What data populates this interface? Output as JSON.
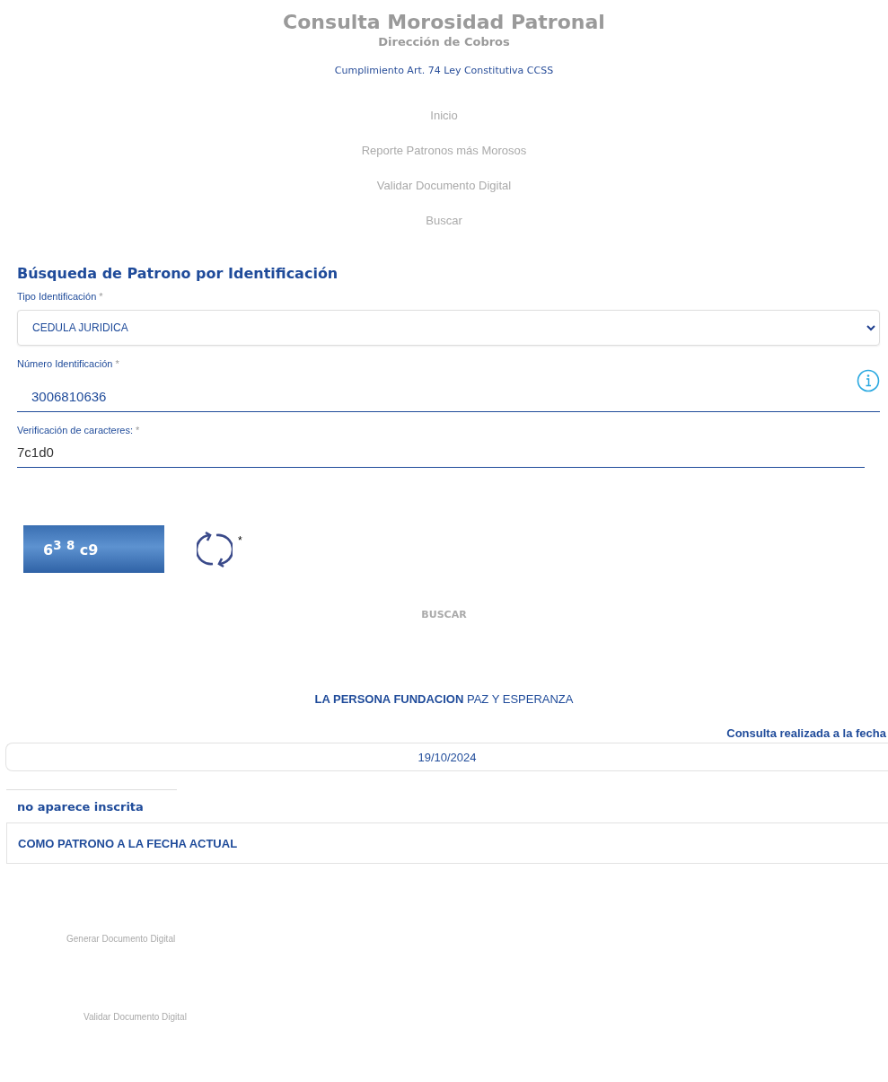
{
  "header": {
    "title": "Consulta Morosidad Patronal",
    "subtitle": "Dirección de Cobros",
    "notice": "Cumplimiento Art. 74 Ley Constitutiva CCSS"
  },
  "nav": [
    "Inicio",
    "Reporte Patronos más Morosos",
    "Validar Documento Digital",
    "Buscar"
  ],
  "search": {
    "title": "Búsqueda de Patrono por Identificación",
    "fields": [
      {
        "kind": "select",
        "label": "Tipo Identificación",
        "mark": "*",
        "value": "CEDULA JURIDICA"
      },
      {
        "kind": "input",
        "label": "Número Identificación",
        "mark": "*",
        "value": "3006810636",
        "info": true
      },
      {
        "kind": "input",
        "label": "Verificación de caracteres:",
        "mark": "*",
        "value": "7c1d0",
        "info": false
      }
    ],
    "captcha": "6$^{3}$ $^{8}$ c9",
    "refresh_mark": "*",
    "button": "BUSCAR"
  },
  "result": {
    "person": "**LA PERSONA FUNDACION** PAZ Y ESPERANZA",
    "date_label": "Consulta realizada a la fecha",
    "date": "19/10/2024",
    "status": "no aparece inscrita",
    "status_detail": "COMO PATRONO A LA FECHA ACTUAL"
  },
  "links": [
    "Generar Documento Digital",
    "Validar Documento Digital"
  ]
}
